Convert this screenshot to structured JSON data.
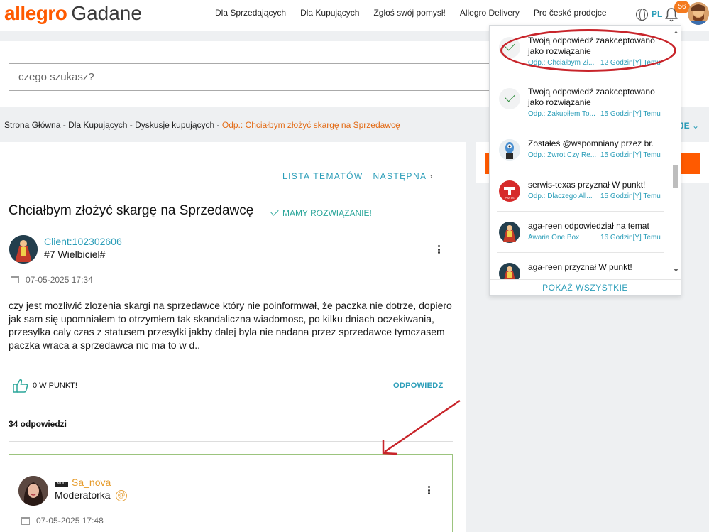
{
  "header": {
    "brand": "allegro",
    "subbrand": "Gadane",
    "nav": [
      "Dla Sprzedających",
      "Dla Kupujących",
      "Zgłoś swój pomysł!",
      "Allegro Delivery",
      "Pro české prodejce"
    ],
    "language": "PL",
    "notification_count": "56"
  },
  "search": {
    "placeholder": "czego szukasz?"
  },
  "breadcrumb": {
    "items": [
      "Strona Główna",
      "Dla Kupujących",
      "Dyskusje kupujących"
    ],
    "separator": " - ",
    "current": "Odp.: Chciałbym złożyć skargę na Sprzedawcę",
    "right_label": "JE"
  },
  "topic": {
    "nav_list": "LISTA TEMATÓW",
    "nav_next": "NASTĘPNA",
    "title": "Chciałbym złożyć skargę na Sprzedawcę",
    "solved_label": "MAMY ROZWIĄZANIE!",
    "author": "Client:102302606",
    "rank": "#7 Wielbiciel#",
    "date": "07-05-2025 17:34",
    "body": "czy jest mozliwić zlozenia skargi na sprzedawce który nie poinformwał, że paczka nie dotrze, dopiero jak sam się upomniałem to otrzymłem tak skandaliczna wiadomosc, po kilku dniach oczekiwania, przesylka caly czas z statusem przesylki jakby dalej byla nie nadana przez sprzedawce tymczasem paczka wraca a sprzedawca nic ma to w d..",
    "points_label": "0 W PUNKT!",
    "reply_label": "ODPOWIEDZ",
    "replies_count": "34 odpowiedzi"
  },
  "reply_post": {
    "mod_tag": "MOD",
    "author": "Sa_nova",
    "role": "Moderatorka",
    "date": "07-05-2025 17:48"
  },
  "notifications": {
    "items": [
      {
        "icon": "check-icon",
        "text": "Twoją odpowiedź zaakceptowano jako rozwiązanie",
        "ref": "Odp.: Chciałbym Zł...",
        "ago": "12 Godzin[Y] Temu"
      },
      {
        "icon": "check-icon",
        "text": "Twoją odpowiedź zaakceptowano jako rozwiązanie",
        "ref": "Odp.: Zakupiłem To...",
        "ago": "15 Godzin[Y] Temu"
      },
      {
        "icon": "user-avatar-icon",
        "text": "Zostałeś @wspomniany przez br.",
        "ref": "Odp.: Zwrot Czy Re...",
        "ago": "15 Godzin[Y] Temu"
      },
      {
        "icon": "user-avatar-icon",
        "text": "serwis-texas przyznał W punkt!",
        "ref": "Odp.: Dlaczego All...",
        "ago": "15 Godzin[Y] Temu"
      },
      {
        "icon": "user-avatar-icon",
        "text": "aga-reen odpowiedział na temat",
        "ref": "Awaria One Box",
        "ago": "16 Godzin[Y] Temu"
      },
      {
        "icon": "user-avatar-icon",
        "text": "aga-reen przyznał W punkt!",
        "ref": "",
        "ago": ""
      }
    ],
    "show_all": "POKAŻ WSZYSTKIE"
  },
  "colors": {
    "brand": "#ff5a00",
    "link": "#2a9db8",
    "annotation": "#c8242a"
  }
}
